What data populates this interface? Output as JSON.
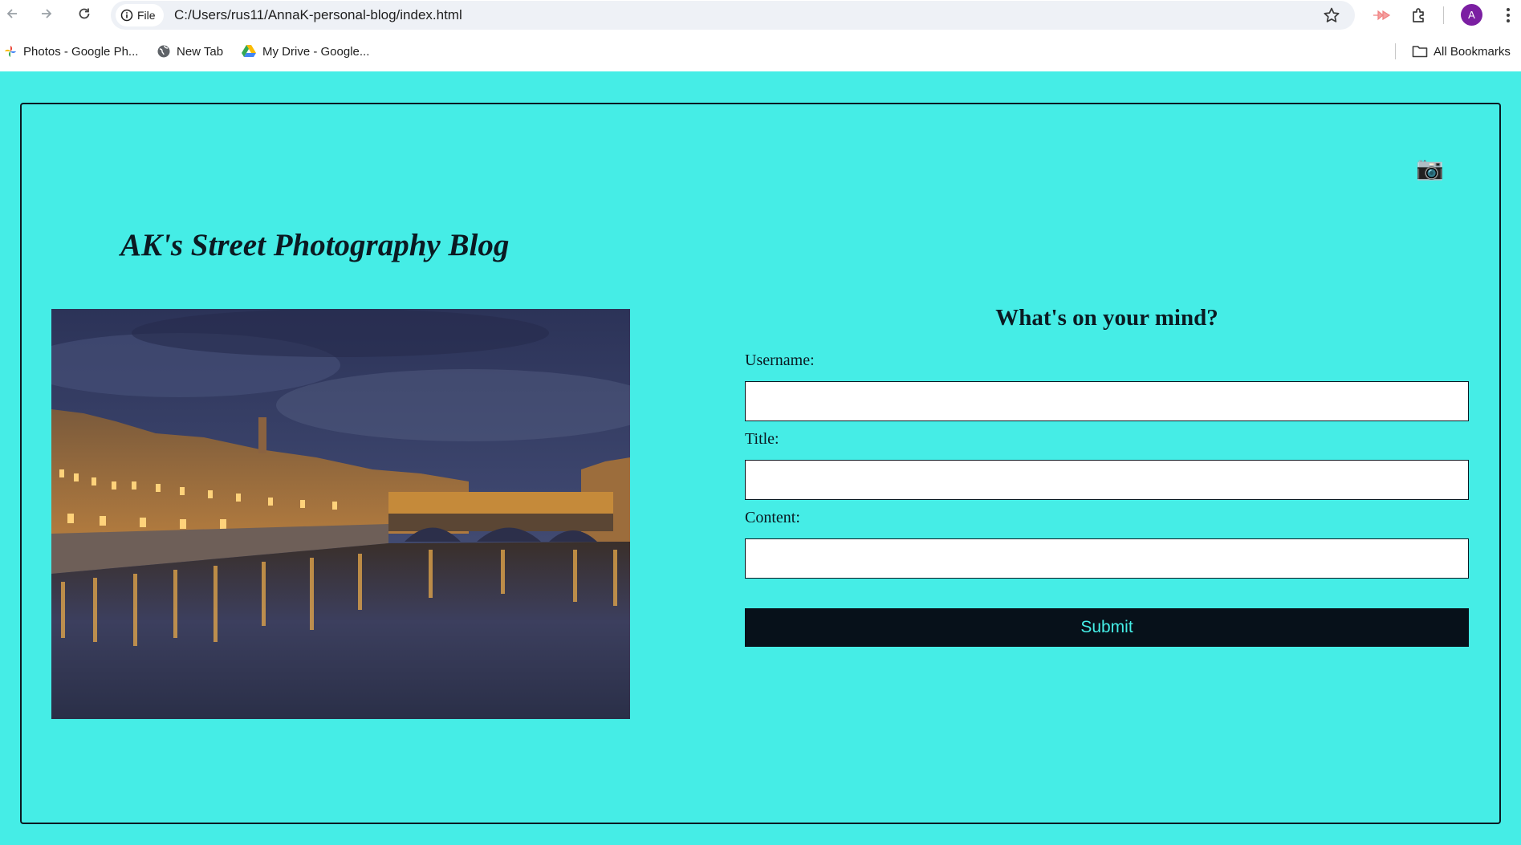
{
  "browser": {
    "site_chip": "File",
    "url": "C:/Users/rus11/AnnaK-personal-blog/index.html",
    "profile_initial": "A",
    "bookmarks": [
      {
        "label": "Photos - Google Ph...",
        "icon": "google-photos-icon"
      },
      {
        "label": "New Tab",
        "icon": "globe-icon"
      },
      {
        "label": "My Drive - Google...",
        "icon": "google-drive-icon"
      }
    ],
    "all_bookmarks": "All Bookmarks"
  },
  "page": {
    "camera_icon": "📷",
    "blog_title": "AK's Street Photography Blog",
    "photo_icon": "photo-florence-ponte-vecchio-night",
    "form": {
      "heading": "What's on your mind?",
      "username_label": "Username:",
      "username_value": "",
      "title_label": "Title:",
      "title_value": "",
      "content_label": "Content:",
      "content_value": "",
      "submit_label": "Submit"
    }
  },
  "colors": {
    "page_background": "#45ede6",
    "border": "#0b1a22",
    "button_background": "#07111a",
    "button_text": "#45ede6"
  }
}
